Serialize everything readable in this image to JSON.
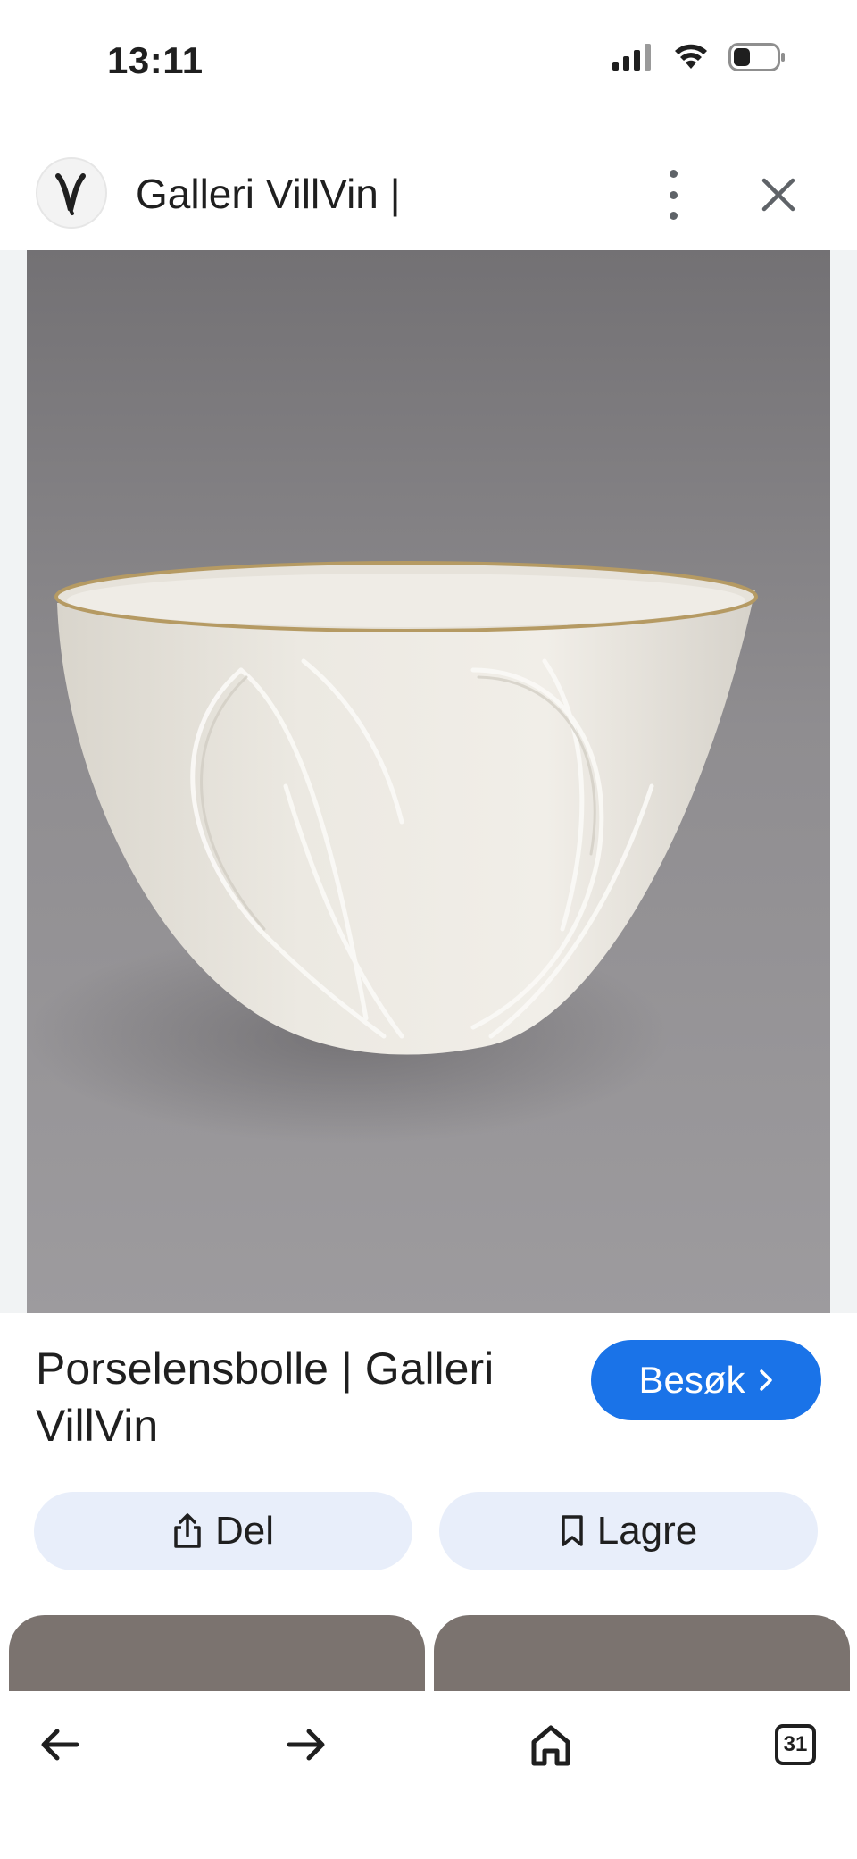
{
  "status_bar": {
    "time": "13:11",
    "icons": [
      "cellular-signal-icon",
      "wifi-icon",
      "battery-icon"
    ]
  },
  "header": {
    "site_title": "Galleri VillVin |",
    "logo_letter": "V",
    "more_icon": "more-vert-icon",
    "close_icon": "close-icon"
  },
  "result": {
    "title": "Porselensbolle | Galleri VillVin",
    "visit_label": "Besøk",
    "visit_icon": "chevron-right-icon"
  },
  "actions": {
    "share_label": "Del",
    "share_icon": "share-icon",
    "save_label": "Lagre",
    "save_icon": "bookmark-icon"
  },
  "bottom_nav": {
    "items": [
      "back-arrow-icon",
      "forward-arrow-icon",
      "home-icon",
      "tabs-icon"
    ],
    "tab_count": "31"
  },
  "colors": {
    "accent": "#1a73e8",
    "pill_bg": "#e8eefa",
    "photo_bg": "#8f8d8f"
  }
}
